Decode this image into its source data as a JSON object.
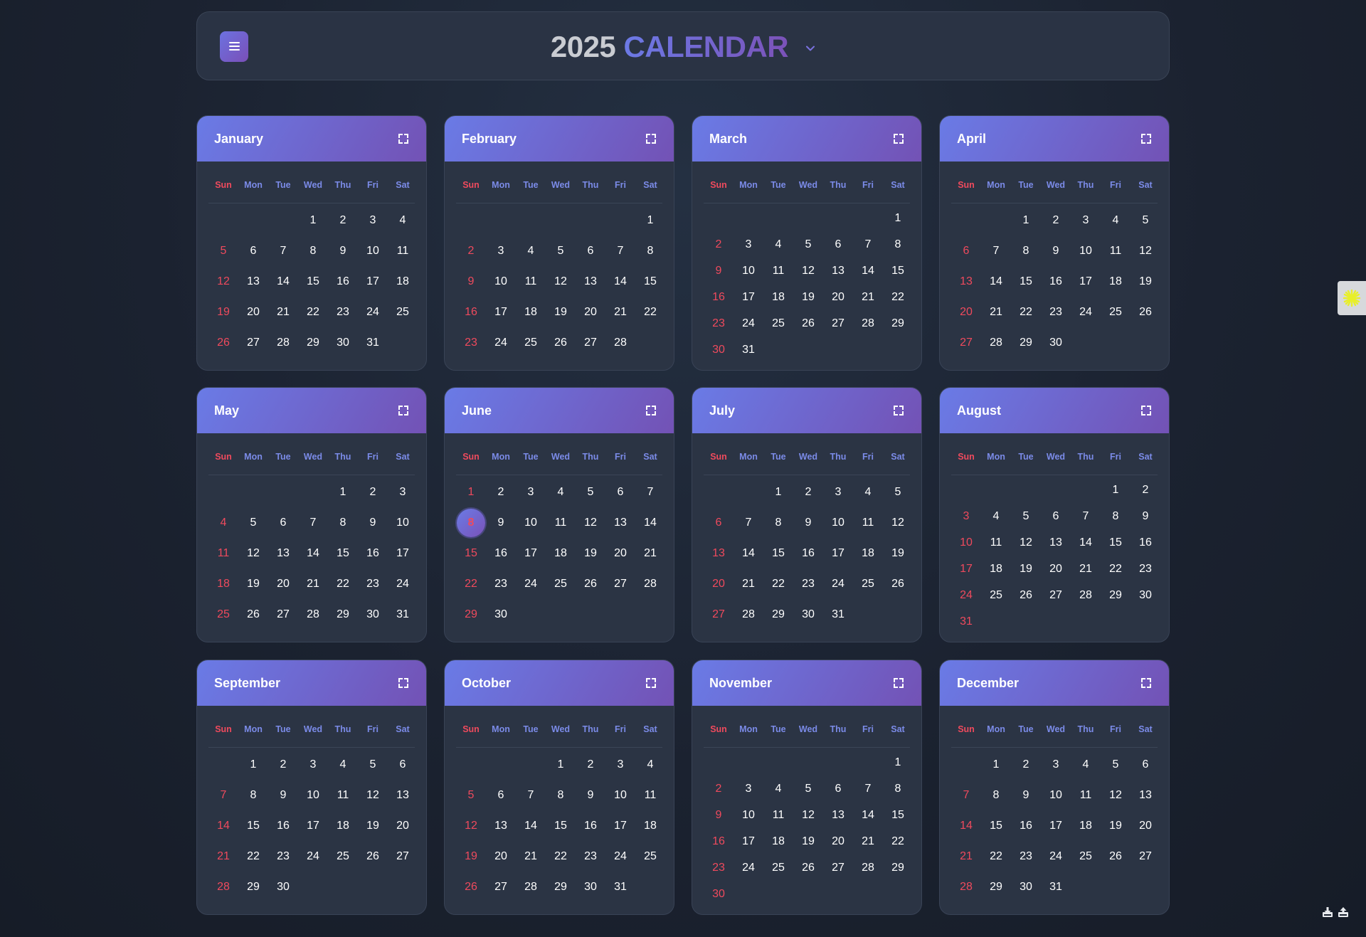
{
  "header": {
    "year": "2025",
    "title": "CALENDAR",
    "menu_icon": "menu-icon",
    "dropdown_icon": "chevron-down-icon"
  },
  "colors": {
    "accent_start": "#6a7be6",
    "accent_end": "#7352b5",
    "sunday": "#ef4a5d",
    "weekday_header": "#7b8be8",
    "card_bg": "#2b3444",
    "page_bg": "#1b2230"
  },
  "weekdays": [
    "Sun",
    "Mon",
    "Tue",
    "Wed",
    "Thu",
    "Fri",
    "Sat"
  ],
  "today": {
    "month": 6,
    "day": 8
  },
  "months": [
    {
      "name": "January",
      "first_weekday": 3,
      "days": 31
    },
    {
      "name": "February",
      "first_weekday": 6,
      "days": 28
    },
    {
      "name": "March",
      "first_weekday": 6,
      "days": 31
    },
    {
      "name": "April",
      "first_weekday": 2,
      "days": 30
    },
    {
      "name": "May",
      "first_weekday": 4,
      "days": 31
    },
    {
      "name": "June",
      "first_weekday": 0,
      "days": 30
    },
    {
      "name": "July",
      "first_weekday": 2,
      "days": 31
    },
    {
      "name": "August",
      "first_weekday": 5,
      "days": 31
    },
    {
      "name": "September",
      "first_weekday": 1,
      "days": 30
    },
    {
      "name": "October",
      "first_weekday": 3,
      "days": 31
    },
    {
      "name": "November",
      "first_weekday": 6,
      "days": 30
    },
    {
      "name": "December",
      "first_weekday": 1,
      "days": 31
    }
  ],
  "month_expand_icon": "expand-icon",
  "side_widget_icon": "sun-burst-icon",
  "bottom_icons": [
    "download-icon",
    "upload-icon"
  ]
}
